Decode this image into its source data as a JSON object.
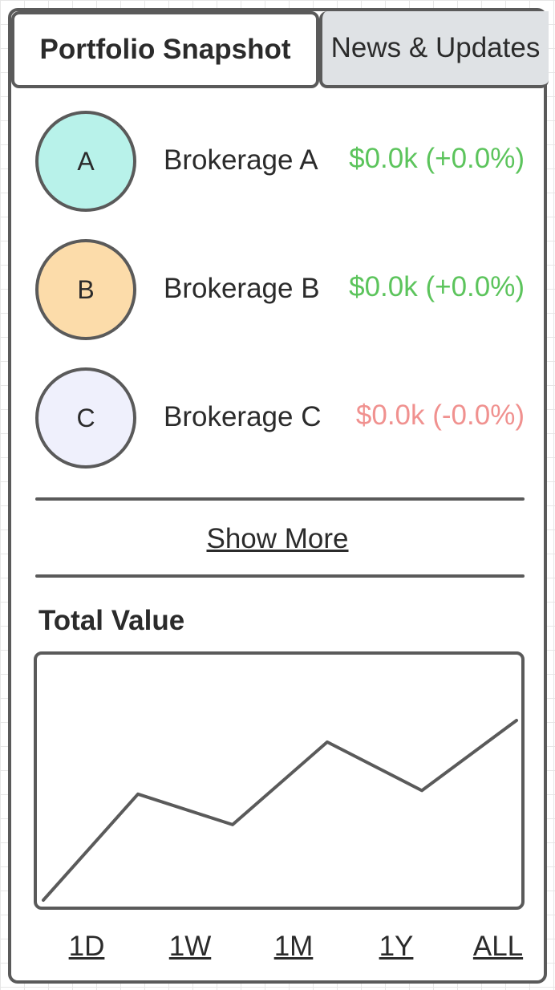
{
  "tabs": {
    "portfolio_label": "Portfolio Snapshot",
    "news_label": "News & Updates"
  },
  "accounts": [
    {
      "initial": "A",
      "name": "Brokerage A",
      "value": "$0.0k (+0.0%)",
      "avatar_color": "#b8f2ea",
      "value_color": "#5cc45c"
    },
    {
      "initial": "B",
      "name": "Brokerage B",
      "value": "$0.0k (+0.0%)",
      "avatar_color": "#fcdcaa",
      "value_color": "#5cc45c"
    },
    {
      "initial": "C",
      "name": "Brokerage C",
      "value": "$0.0k (-0.0%)",
      "avatar_color": "#eff0fc",
      "value_color": "#f0918f"
    }
  ],
  "show_more_label": "Show More",
  "total_value": {
    "title": "Total Value"
  },
  "chart_data": {
    "type": "line",
    "title": "Total Value",
    "x": [
      0,
      1,
      2,
      3,
      4,
      5
    ],
    "values": [
      0,
      0.59,
      0.42,
      0.88,
      0.61,
      1.0
    ],
    "ylim": [
      0,
      1
    ],
    "grid": false,
    "color": "#5a5a5a"
  },
  "time_ranges": [
    "1D",
    "1W",
    "1M",
    "1Y",
    "ALL"
  ]
}
